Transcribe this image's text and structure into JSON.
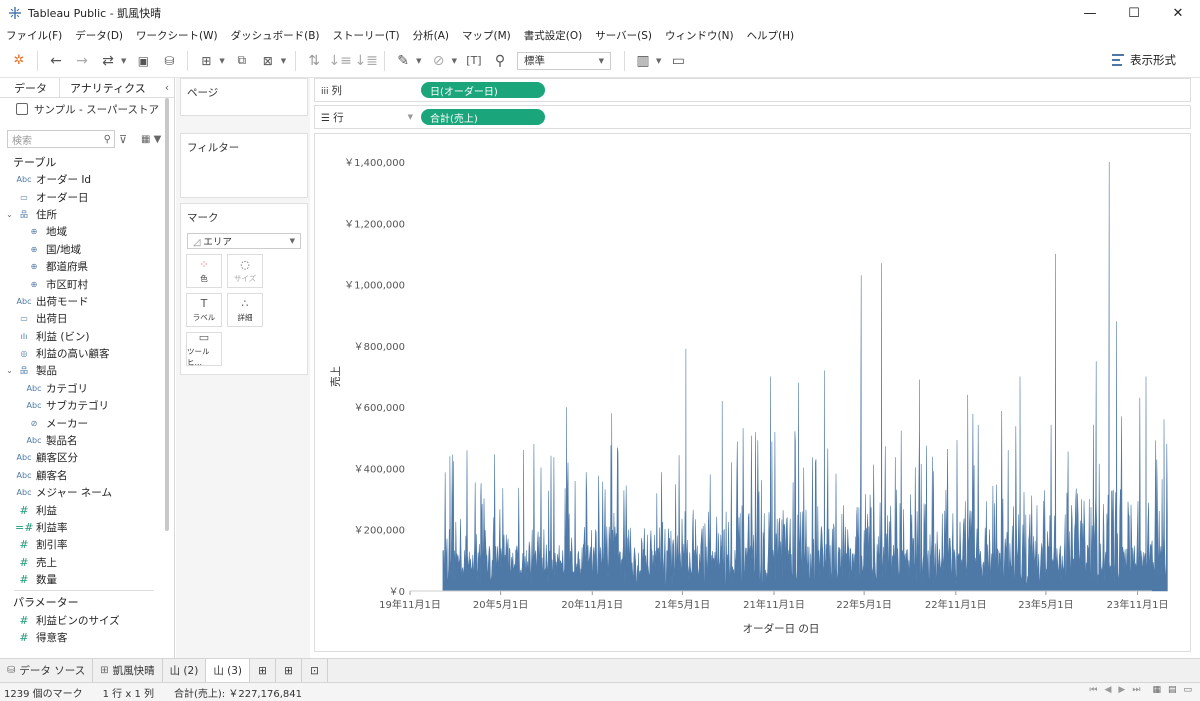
{
  "window": {
    "title": "Tableau Public - 凱風快晴",
    "controls": {
      "minimize": "—",
      "maximize": "☐",
      "close": "✕"
    }
  },
  "menu": [
    "ファイル(F)",
    "データ(D)",
    "ワークシート(W)",
    "ダッシュボード(B)",
    "ストーリー(T)",
    "分析(A)",
    "マップ(M)",
    "書式設定(O)",
    "サーバー(S)",
    "ウィンドウ(N)",
    "ヘルプ(H)"
  ],
  "toolbar": {
    "fit_value": "標準",
    "show_me_label": "表示形式"
  },
  "data_pane": {
    "tab_data": "データ",
    "tab_analytics": "アナリティクス",
    "collapse": "‹",
    "data_source": "サンプル - スーパーストア",
    "search_placeholder": "検索",
    "tables_header": "テーブル",
    "fields": [
      {
        "icon": "Abc",
        "label": "オーダー Id",
        "indent": 0,
        "type": "dim"
      },
      {
        "icon": "▭",
        "label": "オーダー日",
        "indent": 0,
        "type": "date"
      },
      {
        "icon": "品",
        "label": "住所",
        "indent": 0,
        "type": "hier",
        "caret": "⌄"
      },
      {
        "icon": "⊕",
        "label": "地域",
        "indent": 1,
        "type": "geo"
      },
      {
        "icon": "⊕",
        "label": "国/地域",
        "indent": 1,
        "type": "geo"
      },
      {
        "icon": "⊕",
        "label": "都道府県",
        "indent": 1,
        "type": "geo"
      },
      {
        "icon": "⊕",
        "label": "市区町村",
        "indent": 1,
        "type": "geo"
      },
      {
        "icon": "Abc",
        "label": "出荷モード",
        "indent": 0,
        "type": "dim"
      },
      {
        "icon": "▭",
        "label": "出荷日",
        "indent": 0,
        "type": "date"
      },
      {
        "icon": "ılı",
        "label": "利益 (ビン)",
        "indent": 0,
        "type": "bin"
      },
      {
        "icon": "◎",
        "label": "利益の高い顧客",
        "indent": 0,
        "type": "set"
      },
      {
        "icon": "品",
        "label": "製品",
        "indent": 0,
        "type": "hier",
        "caret": "⌄"
      },
      {
        "icon": "Abc",
        "label": "カテゴリ",
        "indent": 1,
        "type": "dim"
      },
      {
        "icon": "Abc",
        "label": "サブカテゴリ",
        "indent": 1,
        "type": "dim"
      },
      {
        "icon": "⊘",
        "label": "メーカー",
        "indent": 1,
        "type": "dim"
      },
      {
        "icon": "Abc",
        "label": "製品名",
        "indent": 1,
        "type": "dim"
      },
      {
        "icon": "Abc",
        "label": "顧客区分",
        "indent": 0,
        "type": "dim"
      },
      {
        "icon": "Abc",
        "label": "顧客名",
        "indent": 0,
        "type": "dim"
      },
      {
        "icon": "Abc",
        "label": "メジャー ネーム",
        "indent": 0,
        "type": "dim"
      },
      {
        "icon": "#",
        "label": "利益",
        "indent": 0,
        "type": "measure"
      },
      {
        "icon": "=#",
        "label": "利益率",
        "indent": 0,
        "type": "measure"
      },
      {
        "icon": "#",
        "label": "割引率",
        "indent": 0,
        "type": "measure"
      },
      {
        "icon": "#",
        "label": "売上",
        "indent": 0,
        "type": "measure"
      },
      {
        "icon": "#",
        "label": "数量",
        "indent": 0,
        "type": "measure"
      }
    ],
    "params_header": "パラメーター",
    "params": [
      {
        "icon": "#",
        "label": "利益ビンのサイズ"
      },
      {
        "icon": "#",
        "label": "得意客"
      }
    ]
  },
  "cards": {
    "pages": "ページ",
    "filters": "フィルター",
    "marks": "マーク",
    "marks_type": "エリア",
    "mark_buttons": [
      {
        "icon": "⁘",
        "label": "色",
        "disabled": false
      },
      {
        "icon": "◌",
        "label": "サイズ",
        "disabled": true
      },
      {
        "icon": "T",
        "label": "ラベル",
        "disabled": false
      },
      {
        "icon": "∴",
        "label": "詳細",
        "disabled": false
      },
      {
        "icon": "▭",
        "label": "ツールヒ…",
        "disabled": false
      }
    ]
  },
  "shelves": {
    "columns_label": "列",
    "columns_pill": "日(オーダー日)",
    "rows_label": "行",
    "rows_pill": "合計(売上)"
  },
  "chart_data": {
    "type": "area",
    "title": "",
    "xlabel": "オーダー日 の日",
    "ylabel": "売上",
    "ylim": [
      0,
      1400000
    ],
    "y_ticks": [
      0,
      200000,
      400000,
      600000,
      800000,
      1000000,
      1200000,
      1400000
    ],
    "y_tick_labels": [
      "￥0",
      "￥200,000",
      "￥400,000",
      "￥600,000",
      "￥800,000",
      "￥1,000,000",
      "￥1,200,000",
      "￥1,400,000"
    ],
    "x_range": [
      "2019-11-01",
      "2023-11-30"
    ],
    "x_ticks": [
      "2019-11-01",
      "2020-05-01",
      "2020-11-01",
      "2021-05-01",
      "2021-11-01",
      "2022-05-01",
      "2022-11-01",
      "2023-05-01",
      "2023-11-01"
    ],
    "x_tick_labels": [
      "19年11月1日",
      "20年5月1日",
      "20年11月1日",
      "21年5月1日",
      "21年11月1日",
      "22年5月1日",
      "22年11月1日",
      "23年5月1日",
      "23年11月1日"
    ],
    "data_start": "2020-01-06",
    "data_end": "2023-12-31",
    "color": "#4e79a7",
    "series": [
      {
        "peaks": [
          {
            "date": "2020-01-20",
            "value": 180000
          },
          {
            "date": "2020-03-22",
            "value": 310000
          },
          {
            "date": "2020-06-16",
            "value": 460000
          },
          {
            "date": "2020-09-10",
            "value": 600000
          },
          {
            "date": "2020-12-10",
            "value": 580000
          },
          {
            "date": "2021-05-08",
            "value": 790000
          },
          {
            "date": "2021-07-20",
            "value": 620000
          },
          {
            "date": "2021-10-25",
            "value": 700000
          },
          {
            "date": "2021-12-20",
            "value": 680000
          },
          {
            "date": "2022-02-10",
            "value": 720000
          },
          {
            "date": "2022-04-25",
            "value": 1030000
          },
          {
            "date": "2022-06-05",
            "value": 1070000
          },
          {
            "date": "2022-08-20",
            "value": 690000
          },
          {
            "date": "2022-11-25",
            "value": 640000
          },
          {
            "date": "2023-03-10",
            "value": 700000
          },
          {
            "date": "2023-05-20",
            "value": 1100000
          },
          {
            "date": "2023-08-10",
            "value": 750000
          },
          {
            "date": "2023-09-05",
            "value": 1400000
          },
          {
            "date": "2023-09-20",
            "value": 880000
          },
          {
            "date": "2023-11-18",
            "value": 700000
          },
          {
            "date": "2023-12-24",
            "value": 560000
          }
        ]
      }
    ]
  },
  "bottom_tabs": {
    "data_source": "データ ソース",
    "tabs": [
      "凱風快晴",
      "山 (2)",
      "山 (3)"
    ],
    "active": "山 (3)"
  },
  "status": {
    "marks": "1239 個のマーク",
    "rows_cols": "1 行 x 1 列",
    "sum": "合計(売上): ￥227,176,841"
  }
}
